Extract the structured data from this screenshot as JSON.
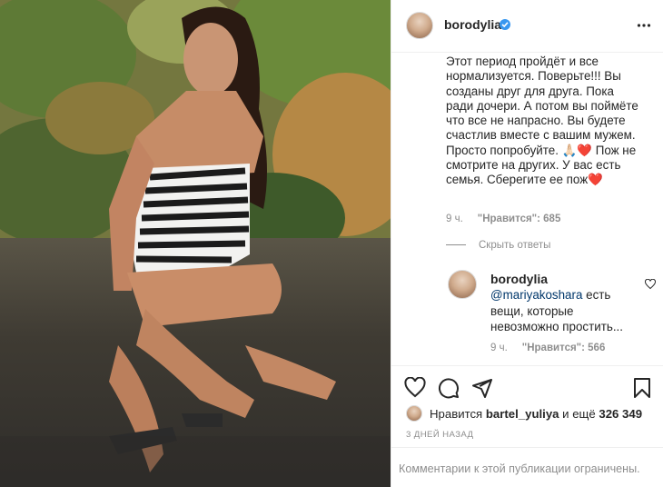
{
  "post": {
    "photo_icon": "photo-of-woman-in-zebra-swimsuit",
    "author": "borodylia"
  },
  "comment": {
    "text": "Этот период пройдёт и все нормализуется. Поверьте!!! Вы созданы друг для друга. Пока ради дочери. А потом вы поймёте что все не напрасно. Вы будете счастлив вместе с вашим мужем. Просто попробуйте. 🙏🏻❤️ Пож не смотрите на других. У вас есть семья. Сберегите ее пож❤️",
    "time": "9 ч.",
    "likes": "\"Нравится\": 685"
  },
  "hide_replies": "Скрыть ответы",
  "reply": {
    "username": "borodylia",
    "mention": "@mariyakoshara",
    "text": " есть вещи, которые невозможно простить...",
    "time": "9 ч.",
    "likes": "\"Нравится\": 566"
  },
  "likes_bar": {
    "prefix": "Нравится ",
    "user": "bartel_yuliya",
    "middle": " и ещё ",
    "count": "326 349"
  },
  "date": "3 ДНЕЙ НАЗАД",
  "footer": "Комментарии к этой публикации ограничены.",
  "colors": {
    "verified": "#3897f0",
    "meta": "#8e8e8e",
    "mention": "#00376b",
    "divider": "#efefef"
  },
  "icons": [
    "more-options-icon",
    "verified-badge-icon",
    "heart-icon",
    "comment-icon",
    "share-icon",
    "bookmark-icon"
  ]
}
